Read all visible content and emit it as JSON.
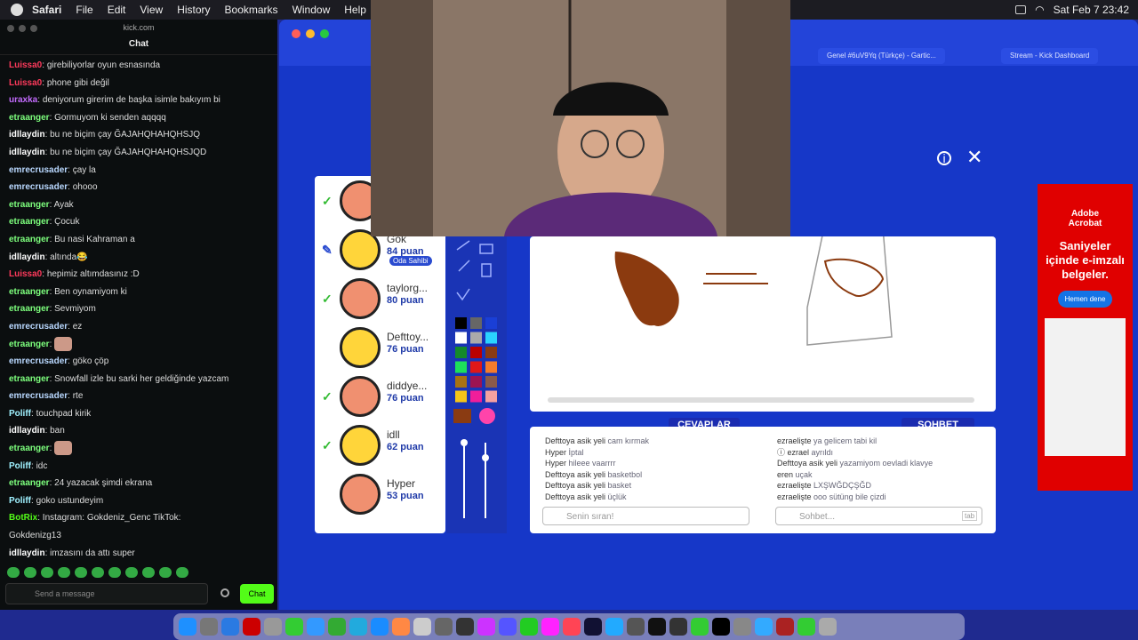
{
  "menubar": {
    "app": "Safari",
    "items": [
      "File",
      "Edit",
      "View",
      "History",
      "Bookmarks",
      "Window",
      "Help"
    ],
    "datetime": "Sat Feb 7  23:42"
  },
  "chat": {
    "domain": "kick.com",
    "title": "Chat",
    "send_placeholder": "Send a message",
    "chat_button": "Chat",
    "messages": [
      {
        "user": "Luissa0",
        "text": "girebiliyorlar oyun esnasında",
        "color": "#ff3a5c"
      },
      {
        "user": "Luissa0",
        "text": "phone gibi değil",
        "color": "#ff3a5c"
      },
      {
        "user": "uraxka",
        "text": "deniyorum girerim de başka isimle bakıyım bi",
        "color": "#c46bff"
      },
      {
        "user": "etraanger",
        "text": "Gormuyom ki senden aqqqq",
        "color": "#7dff7d"
      },
      {
        "user": "idllaydin",
        "text": "bu ne biçim çay ĞAJAHQHAHQHSJQ",
        "color": "#ffffff"
      },
      {
        "user": "idllaydin",
        "text": "bu ne biçim çay ĞAJAHQHAHQHSJQD",
        "color": "#ffffff"
      },
      {
        "user": "emrecrusader",
        "text": "çay la",
        "color": "#b9d8ff"
      },
      {
        "user": "emrecrusader",
        "text": "ohooo",
        "color": "#b9d8ff"
      },
      {
        "user": "etraanger",
        "text": "Ayak",
        "color": "#7dff7d"
      },
      {
        "user": "etraanger",
        "text": "Çocuk",
        "color": "#7dff7d"
      },
      {
        "user": "etraanger",
        "text": "Bu nasi Kahraman a",
        "color": "#7dff7d"
      },
      {
        "user": "idllaydin",
        "text": "altında😂",
        "color": "#ffffff"
      },
      {
        "user": "Luissa0",
        "text": "hepimiz altımdasınız :D",
        "color": "#ff3a5c"
      },
      {
        "user": "etraanger",
        "text": "Ben oynamiyom ki",
        "color": "#7dff7d"
      },
      {
        "user": "etraanger",
        "text": "Sevmiyom",
        "color": "#7dff7d"
      },
      {
        "user": "emrecrusader",
        "text": "ez",
        "color": "#b9d8ff"
      },
      {
        "user": "etraanger",
        "text": "",
        "color": "#7dff7d",
        "emote": true
      },
      {
        "user": "emrecrusader",
        "text": "göko çöp",
        "color": "#b9d8ff"
      },
      {
        "user": "etraanger",
        "text": "Snowfall izle bu sarki her geldiğinde yazcam",
        "color": "#7dff7d"
      },
      {
        "user": "emrecrusader",
        "text": "rte",
        "color": "#b9d8ff"
      },
      {
        "user": "Poliff",
        "text": "touchpad kirik",
        "color": "#9ff1ff"
      },
      {
        "user": "idllaydin",
        "text": "ban",
        "color": "#ffffff"
      },
      {
        "user": "etraanger",
        "text": "",
        "color": "#7dff7d",
        "emote": true
      },
      {
        "user": "Poliff",
        "text": "idc",
        "color": "#9ff1ff"
      },
      {
        "user": "etraanger",
        "text": "24 yazacak şimdi ekrana",
        "color": "#7dff7d"
      },
      {
        "user": "Poliff",
        "text": "goko ustundeyim",
        "color": "#9ff1ff"
      },
      {
        "user": "BotRix",
        "text": "Instagram: Gokdeniz_Genc TikTok:",
        "color": "#53fc18"
      },
      {
        "user": "",
        "text": "Gokdenizg13",
        "color": "#ffffff"
      },
      {
        "user": "idllaydin",
        "text": "imzasını da attı super",
        "color": "#ffffff"
      }
    ]
  },
  "browser": {
    "tabs": [
      "Genel #6uV9Yq (Türkçe) - Gartic...",
      "Stream - Kick Dashboard"
    ]
  },
  "game": {
    "players": [
      {
        "name": "",
        "points": "",
        "check": true
      },
      {
        "name": "Gök",
        "points": "84 puan",
        "owner": "Oda Sahibi",
        "drawing": true
      },
      {
        "name": "taylorg...",
        "points": "80 puan",
        "check": true
      },
      {
        "name": "Defttoy...",
        "points": "76 puan",
        "check": false
      },
      {
        "name": "diddye...",
        "points": "76 puan",
        "check": true
      },
      {
        "name": "idll",
        "points": "62 puan",
        "check": true
      },
      {
        "name": "Hyper",
        "points": "53 puan",
        "check": false
      }
    ],
    "answers_label": "CEVAPLAR",
    "chat_label": "SOHBET",
    "answers": [
      {
        "user": "Defttoya asik yeli",
        "text": "cam kırmak"
      },
      {
        "user": "Hyper",
        "text": "İptal"
      },
      {
        "user": "Hyper",
        "text": "hileee vaarrrr"
      },
      {
        "user": "Defttoya asik yeli",
        "text": "basketbol"
      },
      {
        "user": "Defttoya asik yeli",
        "text": "basket"
      },
      {
        "user": "Defttoya asik yeli",
        "text": "üçlük"
      }
    ],
    "chat": [
      {
        "user": "ezraelişte",
        "text": "ya gelicem tabi kil"
      },
      {
        "user": "ⓘ ezrael",
        "text": "ayrıldı"
      },
      {
        "user": "Defttoya asik yeli",
        "text": "yazamiyom oevladi klavye"
      },
      {
        "user": "eren",
        "text": "uçak"
      },
      {
        "user": "ezraelişte",
        "text": "LXŞWĞDÇŞĞD"
      },
      {
        "user": "ezraelişte",
        "text": "ooo sütüng bile çizdi"
      }
    ],
    "answer_placeholder": "Senin sıran!",
    "chat_placeholder": "Sohbet...",
    "tab_hint": "tab"
  },
  "ad": {
    "brand": "Adobe Acrobat",
    "headline": "Saniyeler içinde e-imzalı belgeler.",
    "cta": "Hemen dene"
  }
}
